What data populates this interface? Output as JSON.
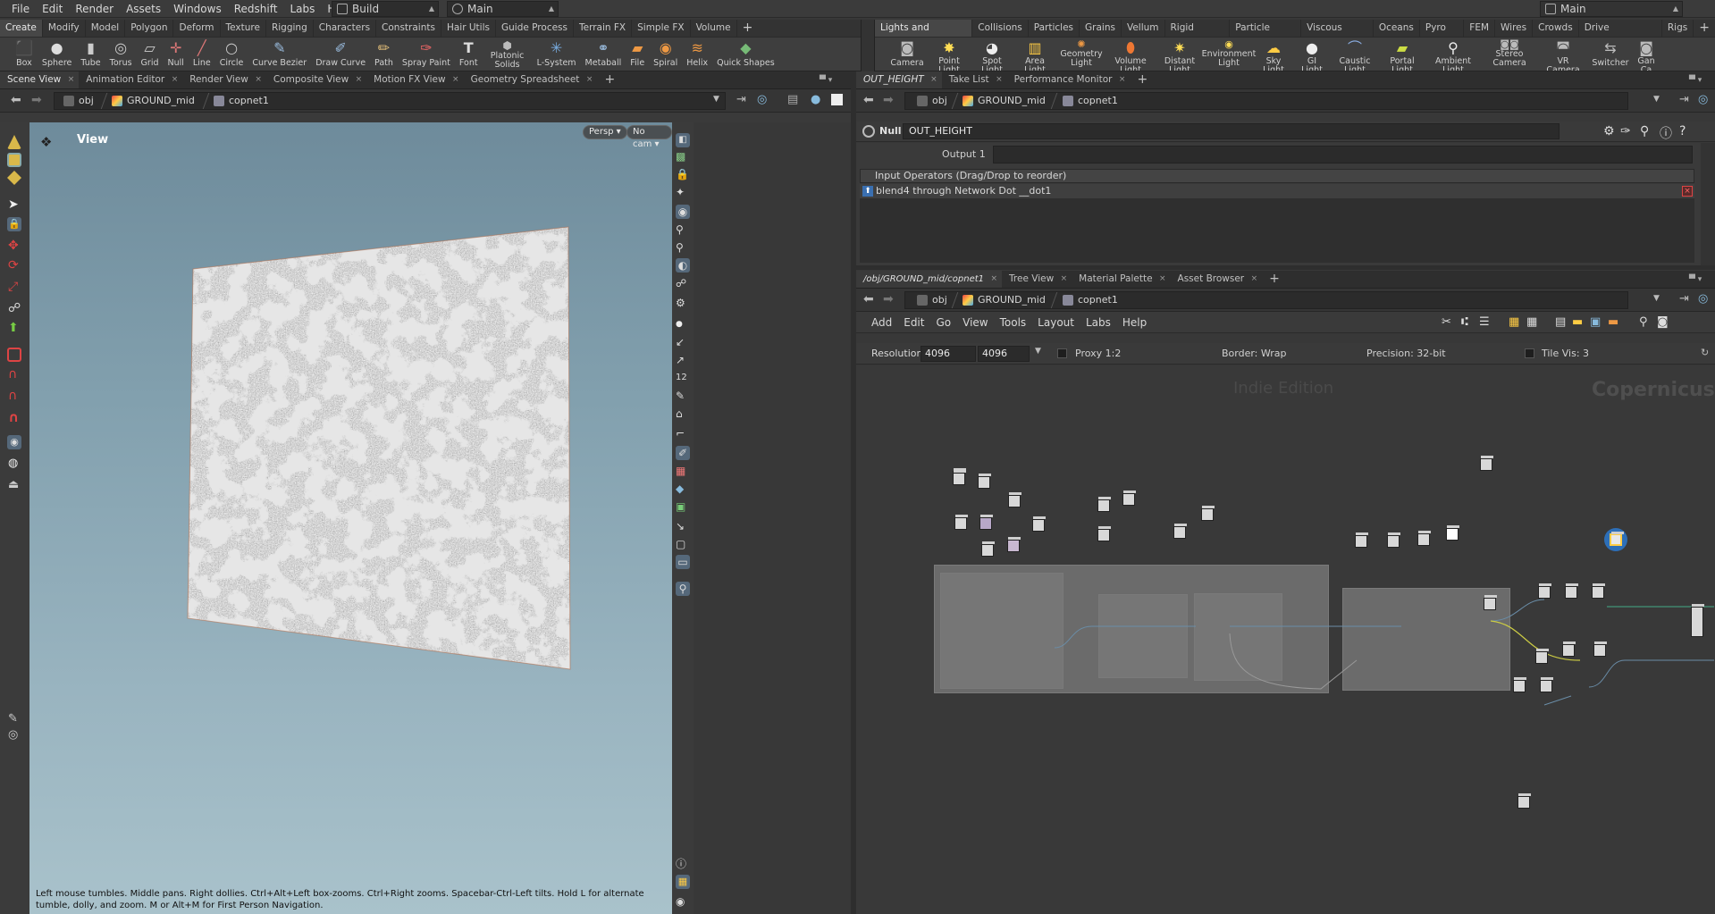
{
  "menubar": {
    "items": [
      "File",
      "Edit",
      "Render",
      "Assets",
      "Windows",
      "Redshift",
      "Labs",
      "Help"
    ],
    "desktop": "Build",
    "context": "Main",
    "right_desktop": "Main"
  },
  "shelf_left": {
    "tabs": [
      "Create",
      "Modify",
      "Model",
      "Polygon",
      "Deform",
      "Texture",
      "Rigging",
      "Characters",
      "Constraints",
      "Hair Utils",
      "Guide Process",
      "Terrain FX",
      "Simple FX",
      "Volume"
    ],
    "active_tab": "Create",
    "tools": [
      {
        "label": "Box",
        "icon": "box-icon"
      },
      {
        "label": "Sphere",
        "icon": "sphere-icon"
      },
      {
        "label": "Tube",
        "icon": "tube-icon"
      },
      {
        "label": "Torus",
        "icon": "torus-icon"
      },
      {
        "label": "Grid",
        "icon": "grid-icon"
      },
      {
        "label": "Null",
        "icon": "null-icon"
      },
      {
        "label": "Line",
        "icon": "line-icon"
      },
      {
        "label": "Circle",
        "icon": "circle-icon"
      },
      {
        "label": "Curve Bezier",
        "icon": "curve-bezier-icon"
      },
      {
        "label": "Draw Curve",
        "icon": "draw-curve-icon"
      },
      {
        "label": "Path",
        "icon": "path-icon"
      },
      {
        "label": "Spray Paint",
        "icon": "spray-paint-icon"
      },
      {
        "label": "Font",
        "icon": "font-icon"
      },
      {
        "label": "Platonic Solids",
        "icon": "platonic-icon"
      },
      {
        "label": "L-System",
        "icon": "lsystem-icon"
      },
      {
        "label": "Metaball",
        "icon": "metaball-icon"
      },
      {
        "label": "File",
        "icon": "file-icon"
      },
      {
        "label": "Spiral",
        "icon": "spiral-icon"
      },
      {
        "label": "Helix",
        "icon": "helix-icon"
      },
      {
        "label": "Quick Shapes",
        "icon": "quick-shapes-icon"
      }
    ]
  },
  "shelf_right": {
    "tabs": [
      "Lights and Cameras",
      "Collisions",
      "Particles",
      "Grains",
      "Vellum",
      "Rigid Bodies",
      "Particle Fluids",
      "Viscous Fluids",
      "Oceans",
      "Pyro FX",
      "FEM",
      "Wires",
      "Crowds",
      "Drive Simulation",
      "Rigs"
    ],
    "active_tab": "Lights and Cameras",
    "tools": [
      {
        "label": "Camera",
        "icon": "camera-icon"
      },
      {
        "label": "Point Light",
        "icon": "point-light-icon"
      },
      {
        "label": "Spot Light",
        "icon": "spot-light-icon"
      },
      {
        "label": "Area Light",
        "icon": "area-light-icon"
      },
      {
        "label": "Geometry Light",
        "icon": "geometry-light-icon"
      },
      {
        "label": "Volume Light",
        "icon": "volume-light-icon"
      },
      {
        "label": "Distant Light",
        "icon": "distant-light-icon"
      },
      {
        "label": "Environment Light",
        "icon": "environment-light-icon"
      },
      {
        "label": "Sky Light",
        "icon": "sky-light-icon"
      },
      {
        "label": "GI Light",
        "icon": "gi-light-icon"
      },
      {
        "label": "Caustic Light",
        "icon": "caustic-light-icon"
      },
      {
        "label": "Portal Light",
        "icon": "portal-light-icon"
      },
      {
        "label": "Ambient Light",
        "icon": "ambient-light-icon"
      },
      {
        "label": "Stereo Camera",
        "icon": "stereo-camera-icon"
      },
      {
        "label": "VR Camera",
        "icon": "vr-camera-icon"
      },
      {
        "label": "Switcher",
        "icon": "switcher-icon"
      },
      {
        "label": "Gan Ca",
        "icon": "gamepad-camera-icon"
      }
    ]
  },
  "left_pane": {
    "tabs": [
      "Scene View",
      "Animation Editor",
      "Render View",
      "Composite View",
      "Motion FX View",
      "Geometry Spreadsheet"
    ],
    "active_tab": "Scene View",
    "path": [
      "obj",
      "GROUND_mid",
      "copnet1"
    ],
    "viewport": {
      "title": "View",
      "persp": "Persp",
      "cam": "No cam",
      "hint": "Left mouse tumbles. Middle pans. Right dollies. Ctrl+Alt+Left box-zooms. Ctrl+Right zooms. Spacebar-Ctrl-Left tilts. Hold L for alternate tumble, dolly, and zoom. M or Alt+M for First Person Navigation."
    }
  },
  "param_pane": {
    "tabs": [
      "OUT_HEIGHT",
      "Take List",
      "Performance Monitor"
    ],
    "active_tab": "OUT_HEIGHT",
    "path": [
      "obj",
      "GROUND_mid",
      "copnet1"
    ],
    "node_type": "Null",
    "node_name": "OUT_HEIGHT",
    "output_label": "Output 1",
    "inputs_header": "Input Operators (Drag/Drop to reorder)",
    "input_item": "blend4 through Network Dot __dot1"
  },
  "network_pane": {
    "tabs": [
      "/obj/GROUND_mid/copnet1",
      "Tree View",
      "Material Palette",
      "Asset Browser"
    ],
    "active_tab": "/obj/GROUND_mid/copnet1",
    "path": [
      "obj",
      "GROUND_mid",
      "copnet1"
    ],
    "menu": [
      "Add",
      "Edit",
      "Go",
      "View",
      "Tools",
      "Layout",
      "Labs",
      "Help"
    ],
    "resolution_label": "Resolution",
    "res_x": "4096",
    "res_y": "4096",
    "proxy": "Proxy 1:2",
    "border": "Border: Wrap",
    "precision": "Precision: 32-bit",
    "tile_vis": "Tile Vis: 3",
    "watermark_edition": "Indie Edition",
    "watermark_context": "Copernicus"
  }
}
